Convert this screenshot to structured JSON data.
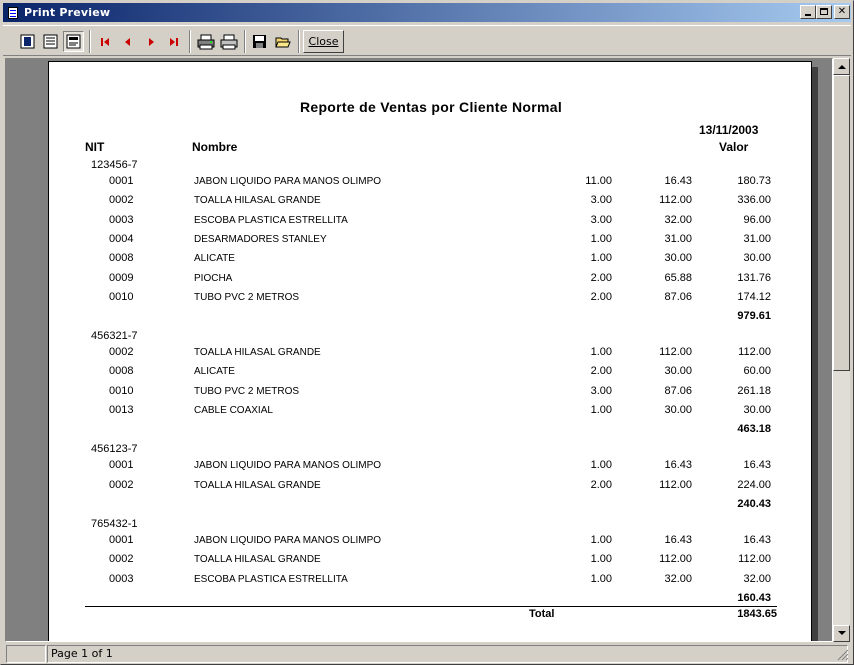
{
  "window": {
    "title": "Print Preview"
  },
  "toolbar": {
    "close_label": "Close"
  },
  "status": {
    "page_indicator": "Page 1 of 1"
  },
  "report": {
    "title": "Reporte de Ventas por Cliente Normal",
    "date": "13/11/2003",
    "headers": {
      "nit": "NIT",
      "nombre": "Nombre",
      "valor": "Valor"
    },
    "groups": [
      {
        "nit": "123456-7",
        "subtotal": "979.61",
        "rows": [
          {
            "code": "0001",
            "name": "JABON LIQUIDO PARA MANOS OLIMPO",
            "qty": "11.00",
            "price": "16.43",
            "value": "180.73"
          },
          {
            "code": "0002",
            "name": "TOALLA HILASAL GRANDE",
            "qty": "3.00",
            "price": "112.00",
            "value": "336.00"
          },
          {
            "code": "0003",
            "name": "ESCOBA PLASTICA ESTRELLITA",
            "qty": "3.00",
            "price": "32.00",
            "value": "96.00"
          },
          {
            "code": "0004",
            "name": "DESARMADORES STANLEY",
            "qty": "1.00",
            "price": "31.00",
            "value": "31.00"
          },
          {
            "code": "0008",
            "name": "ALICATE",
            "qty": "1.00",
            "price": "30.00",
            "value": "30.00"
          },
          {
            "code": "0009",
            "name": "PIOCHA",
            "qty": "2.00",
            "price": "65.88",
            "value": "131.76"
          },
          {
            "code": "0010",
            "name": "TUBO PVC 2 METROS",
            "qty": "2.00",
            "price": "87.06",
            "value": "174.12"
          }
        ]
      },
      {
        "nit": "456321-7",
        "subtotal": "463.18",
        "rows": [
          {
            "code": "0002",
            "name": "TOALLA HILASAL GRANDE",
            "qty": "1.00",
            "price": "112.00",
            "value": "112.00"
          },
          {
            "code": "0008",
            "name": "ALICATE",
            "qty": "2.00",
            "price": "30.00",
            "value": "60.00"
          },
          {
            "code": "0010",
            "name": "TUBO PVC 2 METROS",
            "qty": "3.00",
            "price": "87.06",
            "value": "261.18"
          },
          {
            "code": "0013",
            "name": "CABLE COAXIAL",
            "qty": "1.00",
            "price": "30.00",
            "value": "30.00"
          }
        ]
      },
      {
        "nit": "456123-7",
        "subtotal": "240.43",
        "rows": [
          {
            "code": "0001",
            "name": "JABON LIQUIDO PARA MANOS OLIMPO",
            "qty": "1.00",
            "price": "16.43",
            "value": "16.43"
          },
          {
            "code": "0002",
            "name": "TOALLA HILASAL GRANDE",
            "qty": "2.00",
            "price": "112.00",
            "value": "224.00"
          }
        ]
      },
      {
        "nit": "765432-1",
        "subtotal": "160.43",
        "rows": [
          {
            "code": "0001",
            "name": "JABON LIQUIDO PARA MANOS OLIMPO",
            "qty": "1.00",
            "price": "16.43",
            "value": "16.43"
          },
          {
            "code": "0002",
            "name": "TOALLA HILASAL GRANDE",
            "qty": "1.00",
            "price": "112.00",
            "value": "112.00"
          },
          {
            "code": "0003",
            "name": "ESCOBA PLASTICA ESTRELLITA",
            "qty": "1.00",
            "price": "32.00",
            "value": "32.00"
          }
        ]
      }
    ],
    "total_label": "Total",
    "total_value": "1843.65"
  }
}
